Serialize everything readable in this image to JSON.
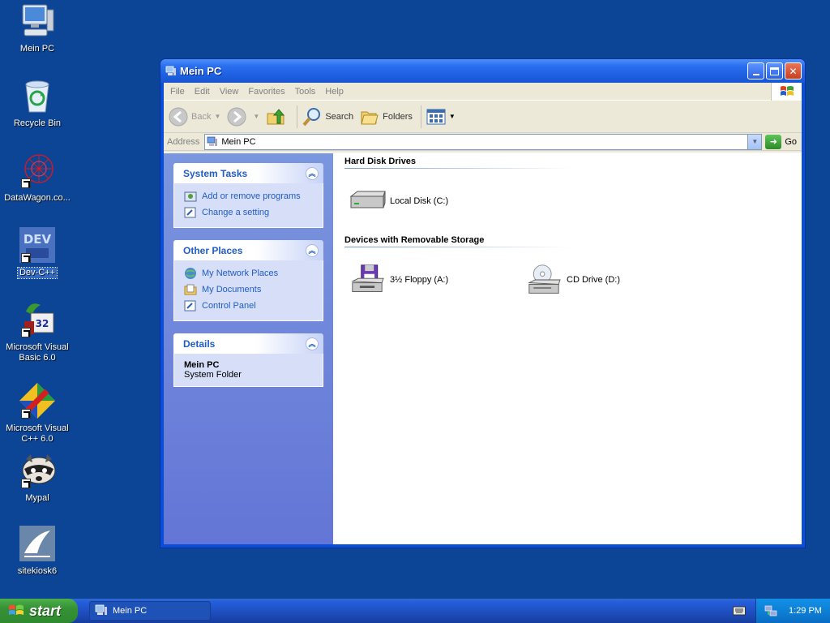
{
  "desktop": {
    "icons": [
      {
        "label": "Mein PC",
        "icon": "computer-icon"
      },
      {
        "label": "Recycle Bin",
        "icon": "recycle-bin-icon"
      },
      {
        "label": "DataWagon.co...",
        "icon": "datawagon-icon"
      },
      {
        "label": "Dev-C++",
        "icon": "dev-cpp-icon"
      },
      {
        "label": "Microsoft Visual Basic 6.0",
        "icon": "visual-basic-icon"
      },
      {
        "label": "Microsoft Visual C++ 6.0",
        "icon": "visual-cpp-icon"
      },
      {
        "label": "Mypal",
        "icon": "mypal-icon"
      },
      {
        "label": "sitekiosk6",
        "icon": "sitekiosk-icon"
      }
    ]
  },
  "window": {
    "title": "Mein PC",
    "menu": [
      "File",
      "Edit",
      "View",
      "Favorites",
      "Tools",
      "Help"
    ],
    "toolbar": {
      "back": "Back",
      "search": "Search",
      "folders": "Folders"
    },
    "address": {
      "label": "Address",
      "value": "Mein PC",
      "go": "Go"
    },
    "taskpane": {
      "system_tasks": {
        "title": "System Tasks",
        "items": [
          "Add or remove programs",
          "Change a setting"
        ]
      },
      "other_places": {
        "title": "Other Places",
        "items": [
          "My Network Places",
          "My Documents",
          "Control Panel"
        ]
      },
      "details": {
        "title": "Details",
        "name": "Mein PC",
        "type": "System Folder"
      }
    },
    "groups": {
      "hard_disks": {
        "title": "Hard Disk Drives",
        "items": [
          "Local Disk (C:)"
        ]
      },
      "removable": {
        "title": "Devices with Removable Storage",
        "items": [
          "3½ Floppy (A:)",
          "CD Drive (D:)"
        ]
      }
    }
  },
  "taskbar": {
    "start": "start",
    "task": "Mein PC",
    "clock": "1:29 PM"
  },
  "colors": {
    "desktop": "#0d4596",
    "titlebar": "#1d5fe0",
    "taskpane": "#6f86da",
    "link": "#215dc6",
    "start": "#369136"
  }
}
